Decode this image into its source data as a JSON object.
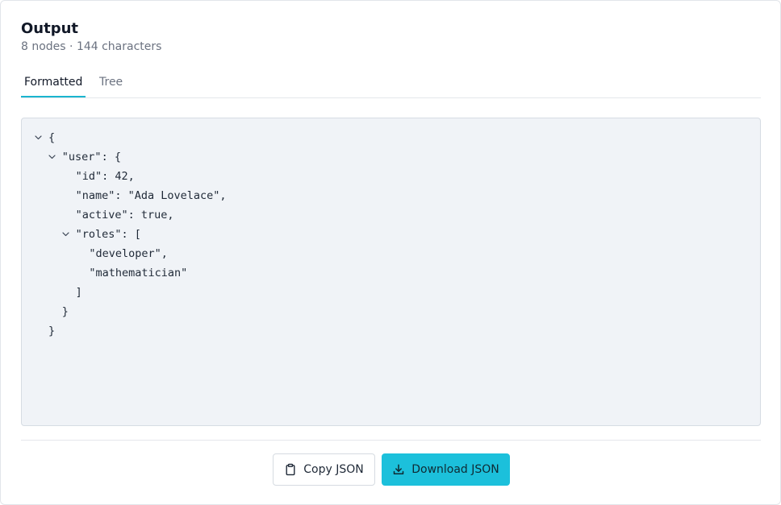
{
  "header": {
    "title": "Output",
    "subtitle": "8 nodes · 144 characters"
  },
  "tabs": [
    {
      "label": "Formatted",
      "active": true
    },
    {
      "label": "Tree",
      "active": false
    }
  ],
  "code": {
    "lines": [
      {
        "text": "{",
        "indent": 0,
        "collapsible": true
      },
      {
        "text": "\"user\": {",
        "indent": 1,
        "collapsible": true
      },
      {
        "text": "\"id\": 42,",
        "indent": 2,
        "collapsible": false
      },
      {
        "text": "\"name\": \"Ada Lovelace\",",
        "indent": 2,
        "collapsible": false
      },
      {
        "text": "\"active\": true,",
        "indent": 2,
        "collapsible": false
      },
      {
        "text": "\"roles\": [",
        "indent": 2,
        "collapsible": true
      },
      {
        "text": "\"developer\",",
        "indent": 3,
        "collapsible": false
      },
      {
        "text": "\"mathematician\"",
        "indent": 3,
        "collapsible": false
      },
      {
        "text": "]",
        "indent": 2,
        "collapsible": false
      },
      {
        "text": "}",
        "indent": 1,
        "collapsible": false
      },
      {
        "text": "}",
        "indent": 0,
        "collapsible": false
      }
    ]
  },
  "actions": {
    "copy_label": "Copy JSON",
    "download_label": "Download JSON"
  },
  "icons": {
    "toggle": "chevron-down-icon",
    "copy": "clipboard-icon",
    "download": "download-icon"
  },
  "colors": {
    "accent": "#1cc0db",
    "code_background": "#f0f3f7"
  }
}
